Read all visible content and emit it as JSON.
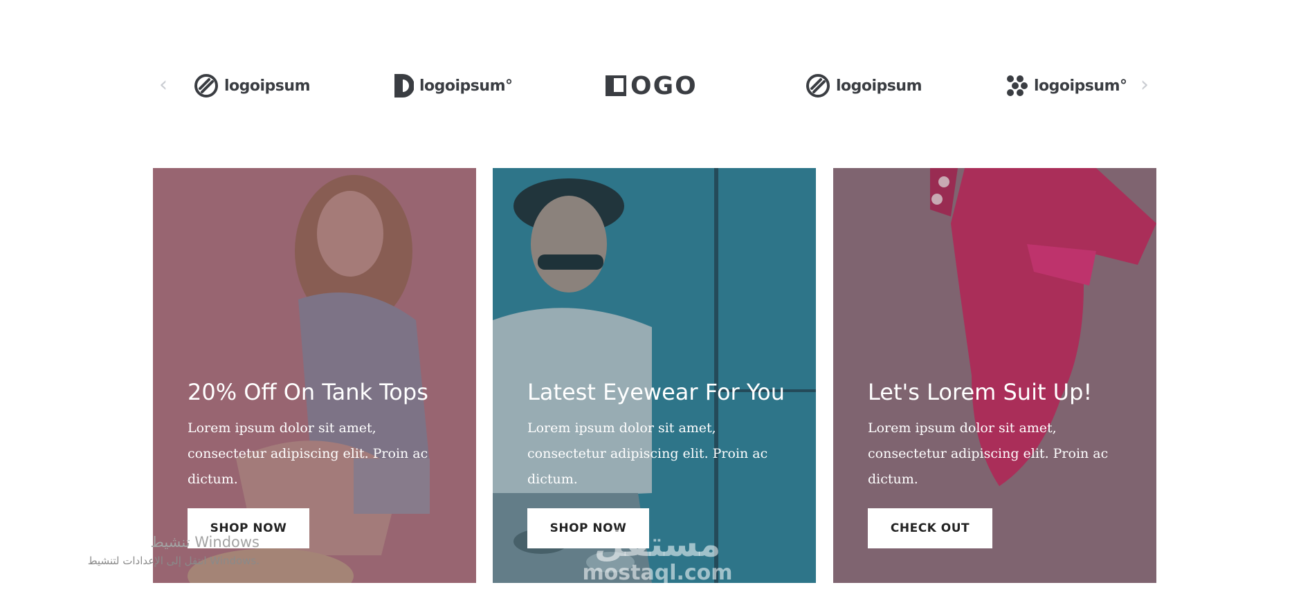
{
  "logos": [
    {
      "icon": "stripe-circle-icon",
      "text": "logoipsum"
    },
    {
      "icon": "half-circle-block-icon",
      "text": "logoipsum°"
    },
    {
      "icon": "square-corner-icon",
      "text": "OGO"
    },
    {
      "icon": "stripe-circle-icon",
      "text": "logoipsum"
    },
    {
      "icon": "dots-cluster-icon",
      "text": "logoipsum°"
    }
  ],
  "carousel": {
    "prev_icon": "‹",
    "next_icon": "›"
  },
  "cards": [
    {
      "title": "20% Off On Tank Tops",
      "text": "Lorem ipsum dolor sit amet, consectetur adipiscing elit. Proin ac dictum.",
      "button": "SHOP NOW",
      "overlay_color": "#7d5560"
    },
    {
      "title": "Latest Eyewear For You",
      "text": "Lorem ipsum dolor sit amet, consectetur adipiscing elit. Proin ac dictum.",
      "button": "SHOP NOW",
      "overlay_color": "#2f5a6a"
    },
    {
      "title": "Let's Lorem Suit Up!",
      "text": "Lorem ipsum dolor sit amet, consectetur adipiscing elit. Proin ac dictum.",
      "button": "CHECK OUT",
      "overlay_color": "#7f6470"
    }
  ],
  "os_notice": {
    "line1": "تنشيط Windows",
    "line2": "انتقل إلى الإعدادات لتنشيط Windows."
  },
  "watermark": {
    "arabic": "مستقل",
    "latin": "mostaql.com"
  }
}
